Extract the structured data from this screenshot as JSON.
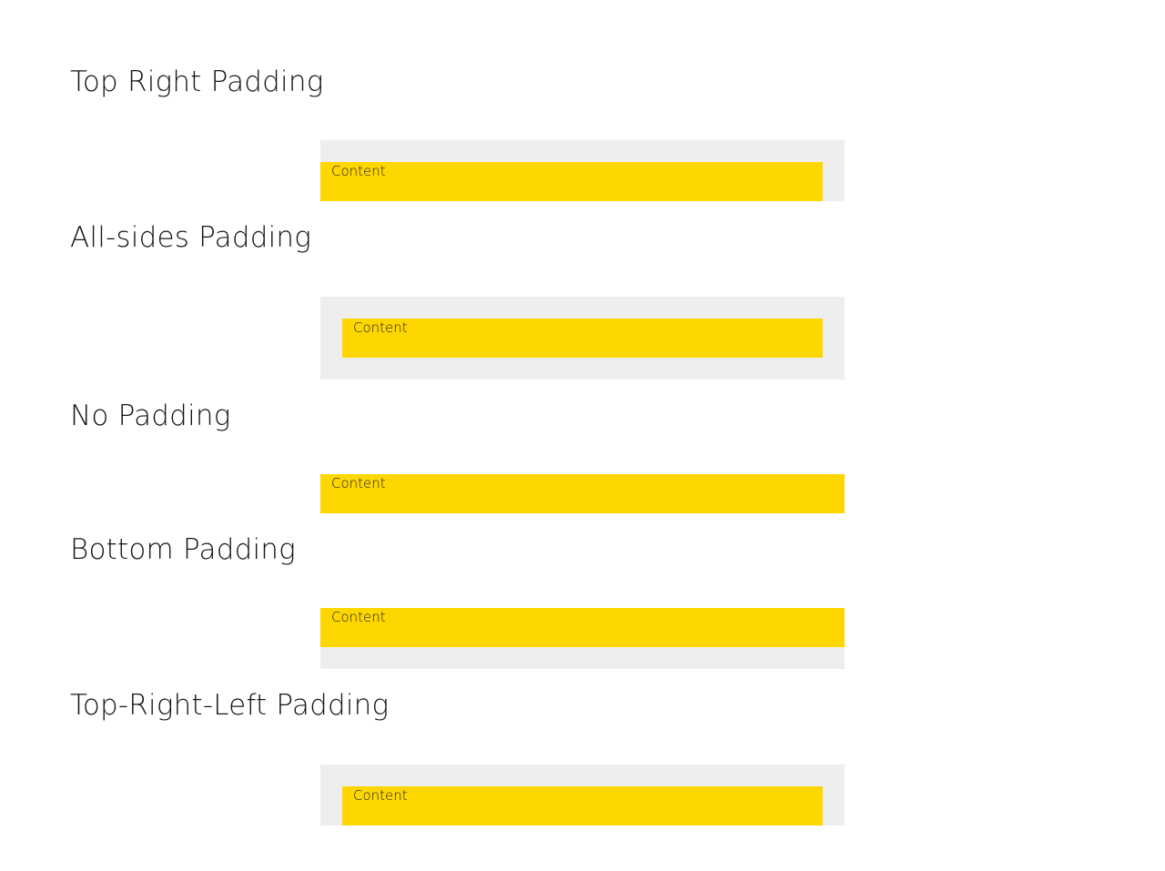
{
  "sections": [
    {
      "title": "Top Right Padding",
      "content_label": "Content"
    },
    {
      "title": "All-sides Padding",
      "content_label": "Content"
    },
    {
      "title": "No Padding",
      "content_label": "Content"
    },
    {
      "title": "Bottom Padding",
      "content_label": "Content"
    },
    {
      "title": "Top-Right-Left Padding",
      "content_label": "Content"
    }
  ],
  "colors": {
    "content_background": "#ffd700",
    "padding_background": "#eeeeee",
    "page_background": "#ffffff"
  }
}
